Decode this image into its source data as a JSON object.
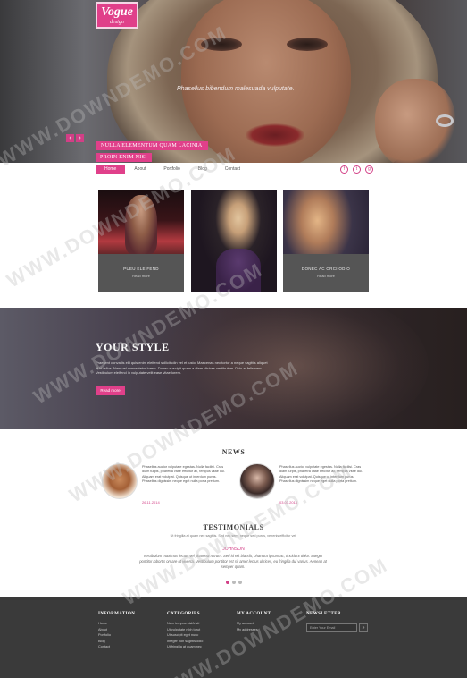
{
  "brand": {
    "name": "Vogue",
    "sub": "design"
  },
  "hero": {
    "tagline": "Phasellus bibendum malesuada vulputate.",
    "caption1": "NULLA ELEMENTUM QUAM LACINIA",
    "caption2": "PROIN ENIM NISI",
    "prev": "‹",
    "next": "›"
  },
  "nav": {
    "items": [
      {
        "label": "Home",
        "active": true
      },
      {
        "label": "About"
      },
      {
        "label": "Portfolio"
      },
      {
        "label": "Blog"
      },
      {
        "label": "Contact"
      }
    ]
  },
  "social": [
    "f",
    "t",
    "g"
  ],
  "gallery": [
    {
      "title": "PUEU ELEIFEND",
      "more": "Read more"
    },
    {
      "title": "",
      "more": ""
    },
    {
      "title": "DONEC AC ORCI ODIO",
      "more": "Read more"
    }
  ],
  "style_section": {
    "title": "YOUR STYLE",
    "body": "Praesent convallis elit quis enim eleifend sollicitudin vel et justo. Maecenas nec tortor a neque sagittis aliquet id id tellus. Nam vel consectetur lorem. Donec suscipit quam a diam ultrices vestibulum. Duis at felis sem. Vestibulum eleifend in vulputate velit ease vitae lorem.",
    "button": "Read more"
  },
  "news": {
    "title": "NEWS",
    "items": [
      {
        "text": "Phasellus auctor vulputate egestas. Nulla facilisi. Cras diam turpis, pharetra vitae efficitur ac, tempus vitae dui. Aliquam erat volutpat. Quisque ut interdum purus. Phasellus dignissim neque eget nulla porta pretium.",
        "date": "26.11.2014"
      },
      {
        "text": "Phasellus auctor vulputate egestas. Nulla facilisi. Cras diam turpis, pharetra vitae efficitur ac, tempus vitae dui. Aliquam erat volutpat. Quisque ut interdum purus. Phasellus dignissim neque eget nulla porta pretium.",
        "date": "03.03.2014"
      }
    ]
  },
  "testimonials": {
    "title": "TESTIMONIALS",
    "sub": "Ut fringilla at quam nec sagittis. Sed nec sem, neque sed purus, venenis efficitur vel.",
    "name": "JOHNSON",
    "quote": "Vestibulum maximus lectus vel pharetra rutrum. Sed id elit blandit, pharetra ipsum ac, tincidunt dolor. Integer porttitor lobortis ornare ut viverra. Vestibulum porttitor est sit amet lectus ultrices, eu fringilla dui varius. Aenean at semper quam."
  },
  "footer": {
    "information": {
      "title": "INFORMATION",
      "items": [
        "Home",
        "About",
        "Portfolio",
        "Blog",
        "Contact"
      ]
    },
    "categories": {
      "title": "CATEGORIES",
      "items": [
        "Nam tempus nisl/tristi",
        "Ut vulputate nibh torut",
        "Ut suscipit eget nunc",
        "Integer non sagittis odio",
        "Ut fringilla at quam nec"
      ]
    },
    "account": {
      "title": "MY ACCOUNT",
      "items": [
        "My account",
        "My addresses"
      ]
    },
    "newsletter": {
      "title": "NEWSLETTER",
      "placeholder": "Enter Your Email",
      "button": "»"
    }
  },
  "watermark": "WWW.DOWNDEMO.COM",
  "colors": {
    "accent": "#e0408a",
    "footer": "#3a3a3a"
  }
}
